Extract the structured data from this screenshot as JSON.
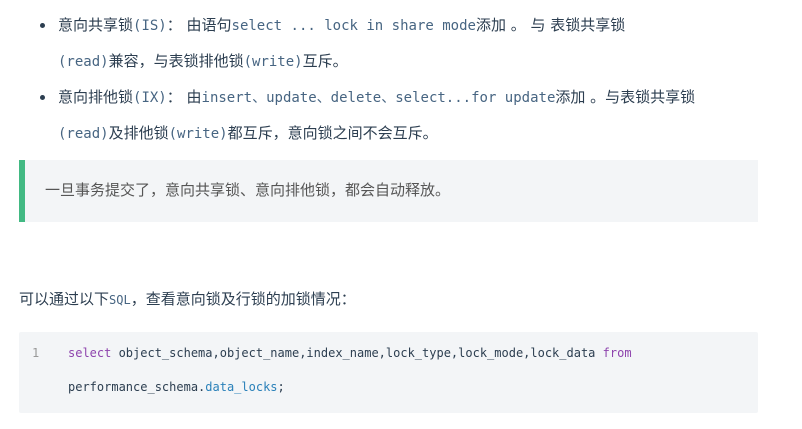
{
  "bullets": [
    {
      "p1": "意向共享锁",
      "p2": "(IS)",
      "p3": "： 由语句",
      "p4": "select ... lock in share mode",
      "p5": "添加 。 与 表锁共享锁",
      "p6": "(read)",
      "p7": "兼容，与表锁排他锁",
      "p8": "(write)",
      "p9": "互斥。"
    },
    {
      "p1": "意向排他锁",
      "p2": "(IX)",
      "p3": "： 由",
      "p4": "insert、update、delete、select...for update",
      "p5": "添加 。与表锁共享锁",
      "p6": "(read)",
      "p7": "及排他锁",
      "p8": "(write)",
      "p9": "都互斥，意向锁之间不会互斥。"
    }
  ],
  "tip": {
    "text": "一旦事务提交了，意向共享锁、意向排他锁，都会自动释放。"
  },
  "paragraph": {
    "before": "可以通过以下",
    "code": "SQL",
    "after": "，查看意向锁及行锁的加锁情况："
  },
  "code_block": {
    "line_number": "1",
    "kw_select": "select",
    "line1_rest": " object_schema,object_name,index_name,lock_type,lock_mode,lock_data ",
    "kw_from": "from",
    "line2_schema": "performance_schema.",
    "line2_table": "data_locks",
    "line2_end": ";"
  },
  "colors": {
    "accent": "#42b983",
    "block_bg": "#f3f5f7",
    "text": "#2c3e50",
    "inline_code": "#476582",
    "keyword": "#8e44ad",
    "property": "#2980b9"
  }
}
